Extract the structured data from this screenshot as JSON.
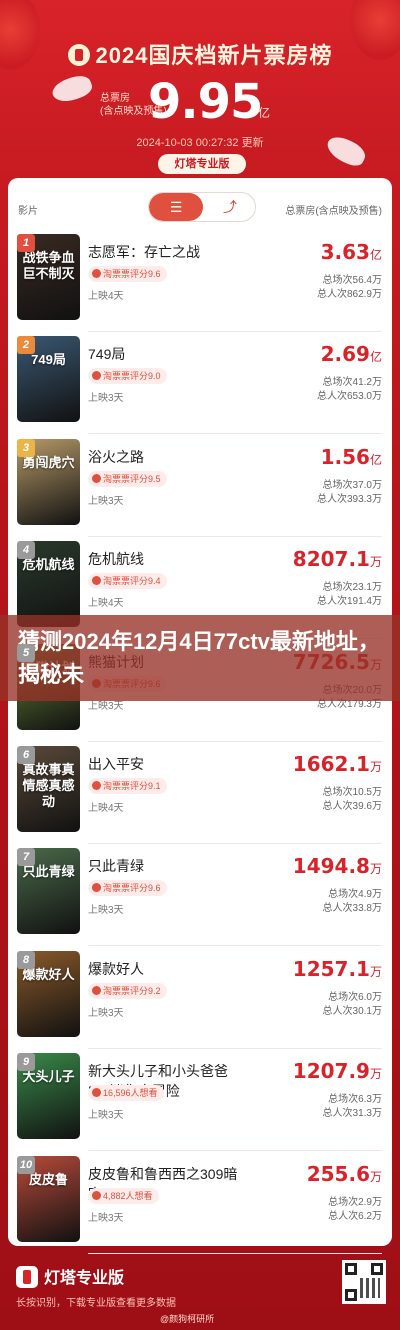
{
  "header": {
    "title": "2024国庆档新片票房榜",
    "total_label_line1": "总票房",
    "total_label_line2": "(含点映及预售)",
    "total_value": "9.95",
    "total_unit": "亿",
    "timestamp": "2024-10-03 00:27:32 更新",
    "brand": "灯塔专业版"
  },
  "table": {
    "toggle_list_icon": "list-icon",
    "toggle_chart_icon": "trend-chart-icon",
    "col_film": "影片",
    "col_box": "总票房(含点映及预售)"
  },
  "films": [
    {
      "rank": "1",
      "name": "志愿军：存亡之战",
      "score": "淘票票评分9.6",
      "days": "上映4天",
      "value": "3.63",
      "unit": "亿",
      "shows": "总场次56.4万",
      "viewers": "总人次862.9万",
      "poster_text": "战铁争血巨不制灭",
      "poster_color": "#3a2a22",
      "rank_color": "#e0503f"
    },
    {
      "rank": "2",
      "name": "749局",
      "score": "淘票票评分9.0",
      "days": "上映3天",
      "value": "2.69",
      "unit": "亿",
      "shows": "总场次41.2万",
      "viewers": "总人次653.0万",
      "poster_text": "749局",
      "poster_color": "#3b5872",
      "rank_color": "#e98a3c"
    },
    {
      "rank": "3",
      "name": "浴火之路",
      "score": "淘票票评分9.5",
      "days": "上映3天",
      "value": "1.56",
      "unit": "亿",
      "shows": "总场次37.0万",
      "viewers": "总人次393.3万",
      "poster_text": "勇闯虎穴",
      "poster_color": "#b79a68",
      "rank_color": "#eab448"
    },
    {
      "rank": "4",
      "name": "危机航线",
      "score": "淘票票评分9.4",
      "days": "上映4天",
      "value": "8207.1",
      "unit": "万",
      "shows": "总场次23.1万",
      "viewers": "总人次191.4万",
      "poster_text": "危机航线",
      "poster_color": "#2a3a2c",
      "rank_color": "#9a9a9a"
    },
    {
      "rank": "5",
      "name": "熊猫计划",
      "score": "淘票票评分9.6",
      "days": "上映3天",
      "value": "7726.5",
      "unit": "万",
      "shows": "总场次20.0万",
      "viewers": "总人次179.3万",
      "poster_text": "熊猫计划",
      "poster_color": "#6a8a3a",
      "rank_color": "#9a9a9a"
    },
    {
      "rank": "6",
      "name": "出入平安",
      "score": "淘票票评分9.1",
      "days": "上映4天",
      "value": "1662.1",
      "unit": "万",
      "shows": "总场次10.5万",
      "viewers": "总人次39.6万",
      "poster_text": "真故事真情感真感动",
      "poster_color": "#5a4a3a",
      "rank_color": "#9a9a9a"
    },
    {
      "rank": "7",
      "name": "只此青绿",
      "score": "淘票票评分9.6",
      "days": "上映3天",
      "value": "1494.8",
      "unit": "万",
      "shows": "总场次4.9万",
      "viewers": "总人次33.8万",
      "poster_text": "只此青绿",
      "poster_color": "#4a6a4a",
      "rank_color": "#9a9a9a"
    },
    {
      "rank": "8",
      "name": "爆款好人",
      "score": "淘票票评分9.2",
      "days": "上映3天",
      "value": "1257.1",
      "unit": "万",
      "shows": "总场次6.0万",
      "viewers": "总人次30.1万",
      "poster_text": "爆款好人",
      "poster_color": "#8a5a2a",
      "rank_color": "#9a9a9a"
    },
    {
      "rank": "9",
      "name": "新大头儿子和小头爸爸5：迷你大冒险",
      "score": "16,596人想看",
      "days": "上映3天",
      "value": "1207.9",
      "unit": "万",
      "shows": "总场次6.3万",
      "viewers": "总人次31.3万",
      "poster_text": "大头儿子",
      "poster_color": "#3a8a4a",
      "rank_color": "#9a9a9a"
    },
    {
      "rank": "10",
      "name": "皮皮鲁和鲁西西之309暗室",
      "score": "4,882人想看",
      "days": "上映3天",
      "value": "255.6",
      "unit": "万",
      "shows": "总场次2.9万",
      "viewers": "总人次6.2万",
      "poster_text": "皮皮鲁",
      "poster_color": "#b84a3a",
      "rank_color": "#9a9a9a"
    }
  ],
  "overlay": {
    "text": "猜测2024年12月4日77ctv最新地址，揭秘未"
  },
  "footer": {
    "brand": "灯塔专业版",
    "note": "长按识别，下载专业版查看更多数据",
    "weibo": "@颜狗柯研所"
  }
}
